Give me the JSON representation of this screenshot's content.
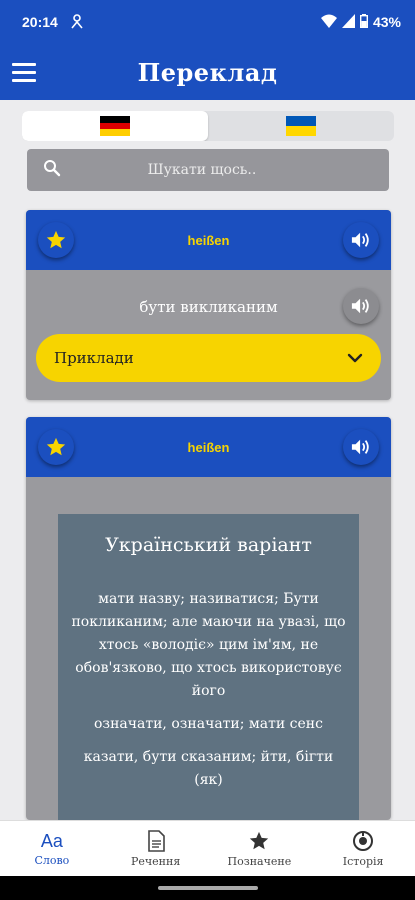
{
  "status": {
    "time": "20:14",
    "battery": "43%"
  },
  "app": {
    "title": "Переклад"
  },
  "languages": [
    {
      "name": "German",
      "flag_colors": [
        "#000000",
        "#dd0000",
        "#ffce00"
      ],
      "active": true
    },
    {
      "name": "Ukrainian",
      "flag_colors": [
        "#0057b7",
        "#ffd700"
      ],
      "active": false
    }
  ],
  "search": {
    "placeholder": "Шукати щось.."
  },
  "cards": [
    {
      "word": "heißen",
      "translation": "бути викликаним",
      "examples_label": "Приклади"
    },
    {
      "word": "heißen",
      "variant_title": "Український варіант",
      "paragraphs": [
        "мати назву; називатися; Бути покликаним; але маючи на увазі, що хтось «володіє» цим ім'ям, не обов'язково, що хтось використовує його",
        "означати, означати; мати сенс",
        "казати, бути сказаним; йти, бігти (як)"
      ]
    }
  ],
  "nav": [
    {
      "icon": "Aa",
      "label": "Слово",
      "active": true
    },
    {
      "label": "Речення",
      "active": false
    },
    {
      "label": "Позначене",
      "active": false
    },
    {
      "label": "Історія",
      "active": false
    }
  ],
  "colors": {
    "primary": "#1b4fbf",
    "accent": "#f7d400",
    "card_bg": "#9a9a9e",
    "variant_bg": "#5f7281"
  }
}
